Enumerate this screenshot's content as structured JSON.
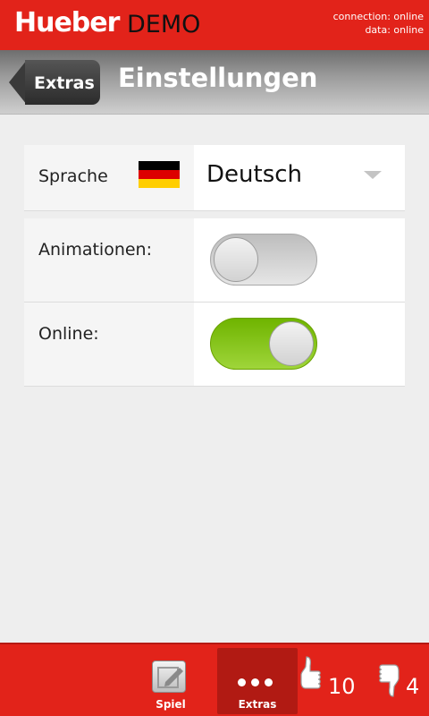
{
  "header": {
    "brand": "Hueber",
    "edition": "DEMO",
    "connection_status": "connection: online",
    "data_status": "data: online",
    "colors": {
      "brand_red": "#e2231a"
    }
  },
  "titlebar": {
    "back_label": "Extras",
    "title": "Einstellungen"
  },
  "settings": {
    "language": {
      "label": "Sprache",
      "flag_icon": "flag-germany-icon",
      "value": "Deutsch"
    },
    "animations": {
      "label": "Animationen:",
      "enabled": false
    },
    "online": {
      "label": "Online:",
      "enabled": true,
      "on_color": "#8cc820"
    }
  },
  "bottom_nav": {
    "tabs": [
      {
        "label": "Spiel",
        "icon": "edit-icon",
        "active": false
      },
      {
        "label": "Extras",
        "icon": "more-icon",
        "active": true
      }
    ],
    "thumbs_up_count": "10",
    "thumbs_down_count": "4"
  }
}
